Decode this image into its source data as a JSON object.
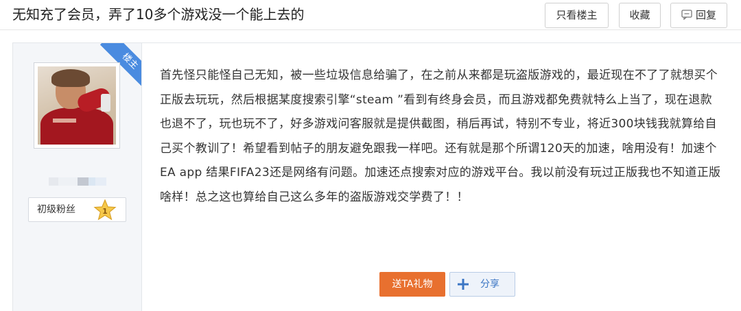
{
  "thread": {
    "title": "无知充了会员，弄了10多个游戏没一个能上去的"
  },
  "toolbar": {
    "only_author": "只看楼主",
    "favorite": "收藏",
    "reply": "回复",
    "reply_icon": "comment-icon"
  },
  "author": {
    "ribbon": "楼主",
    "level_title": "初级粉丝",
    "level_number": "1",
    "level_icon": "star-icon"
  },
  "post": {
    "body": "首先怪只能怪自己无知，被一些垃圾信息给骗了，在之前从来都是玩盗版游戏的，最近现在不了了就想买个正版去玩玩，然后根据某度搜索引擎“steam ”看到有终身会员，而且游戏都免费就特么上当了，现在退款也退不了，玩也玩不了，好多游戏问客服就是提供截图，稍后再试，特别不专业，将近300块钱我就算给自己买个教训了！希望看到帖子的朋友避免跟我一样吧。还有就是那个所谓120天的加速，啥用没有！加速个EA app 结果FIFA23还是网络有问题。加速还点搜索对应的游戏平台。我以前没有玩过正版我也不知道正版啥样！总之这也算给自己这么多年的盗版游戏交学费了！！"
  },
  "actions": {
    "gift": "送TA礼物",
    "share": "分享",
    "share_icon": "plus-icon"
  },
  "colors": {
    "accent_blue": "#4a8be0",
    "gift_orange": "#e8702f",
    "sidebar_bg": "#f4f6f9"
  }
}
